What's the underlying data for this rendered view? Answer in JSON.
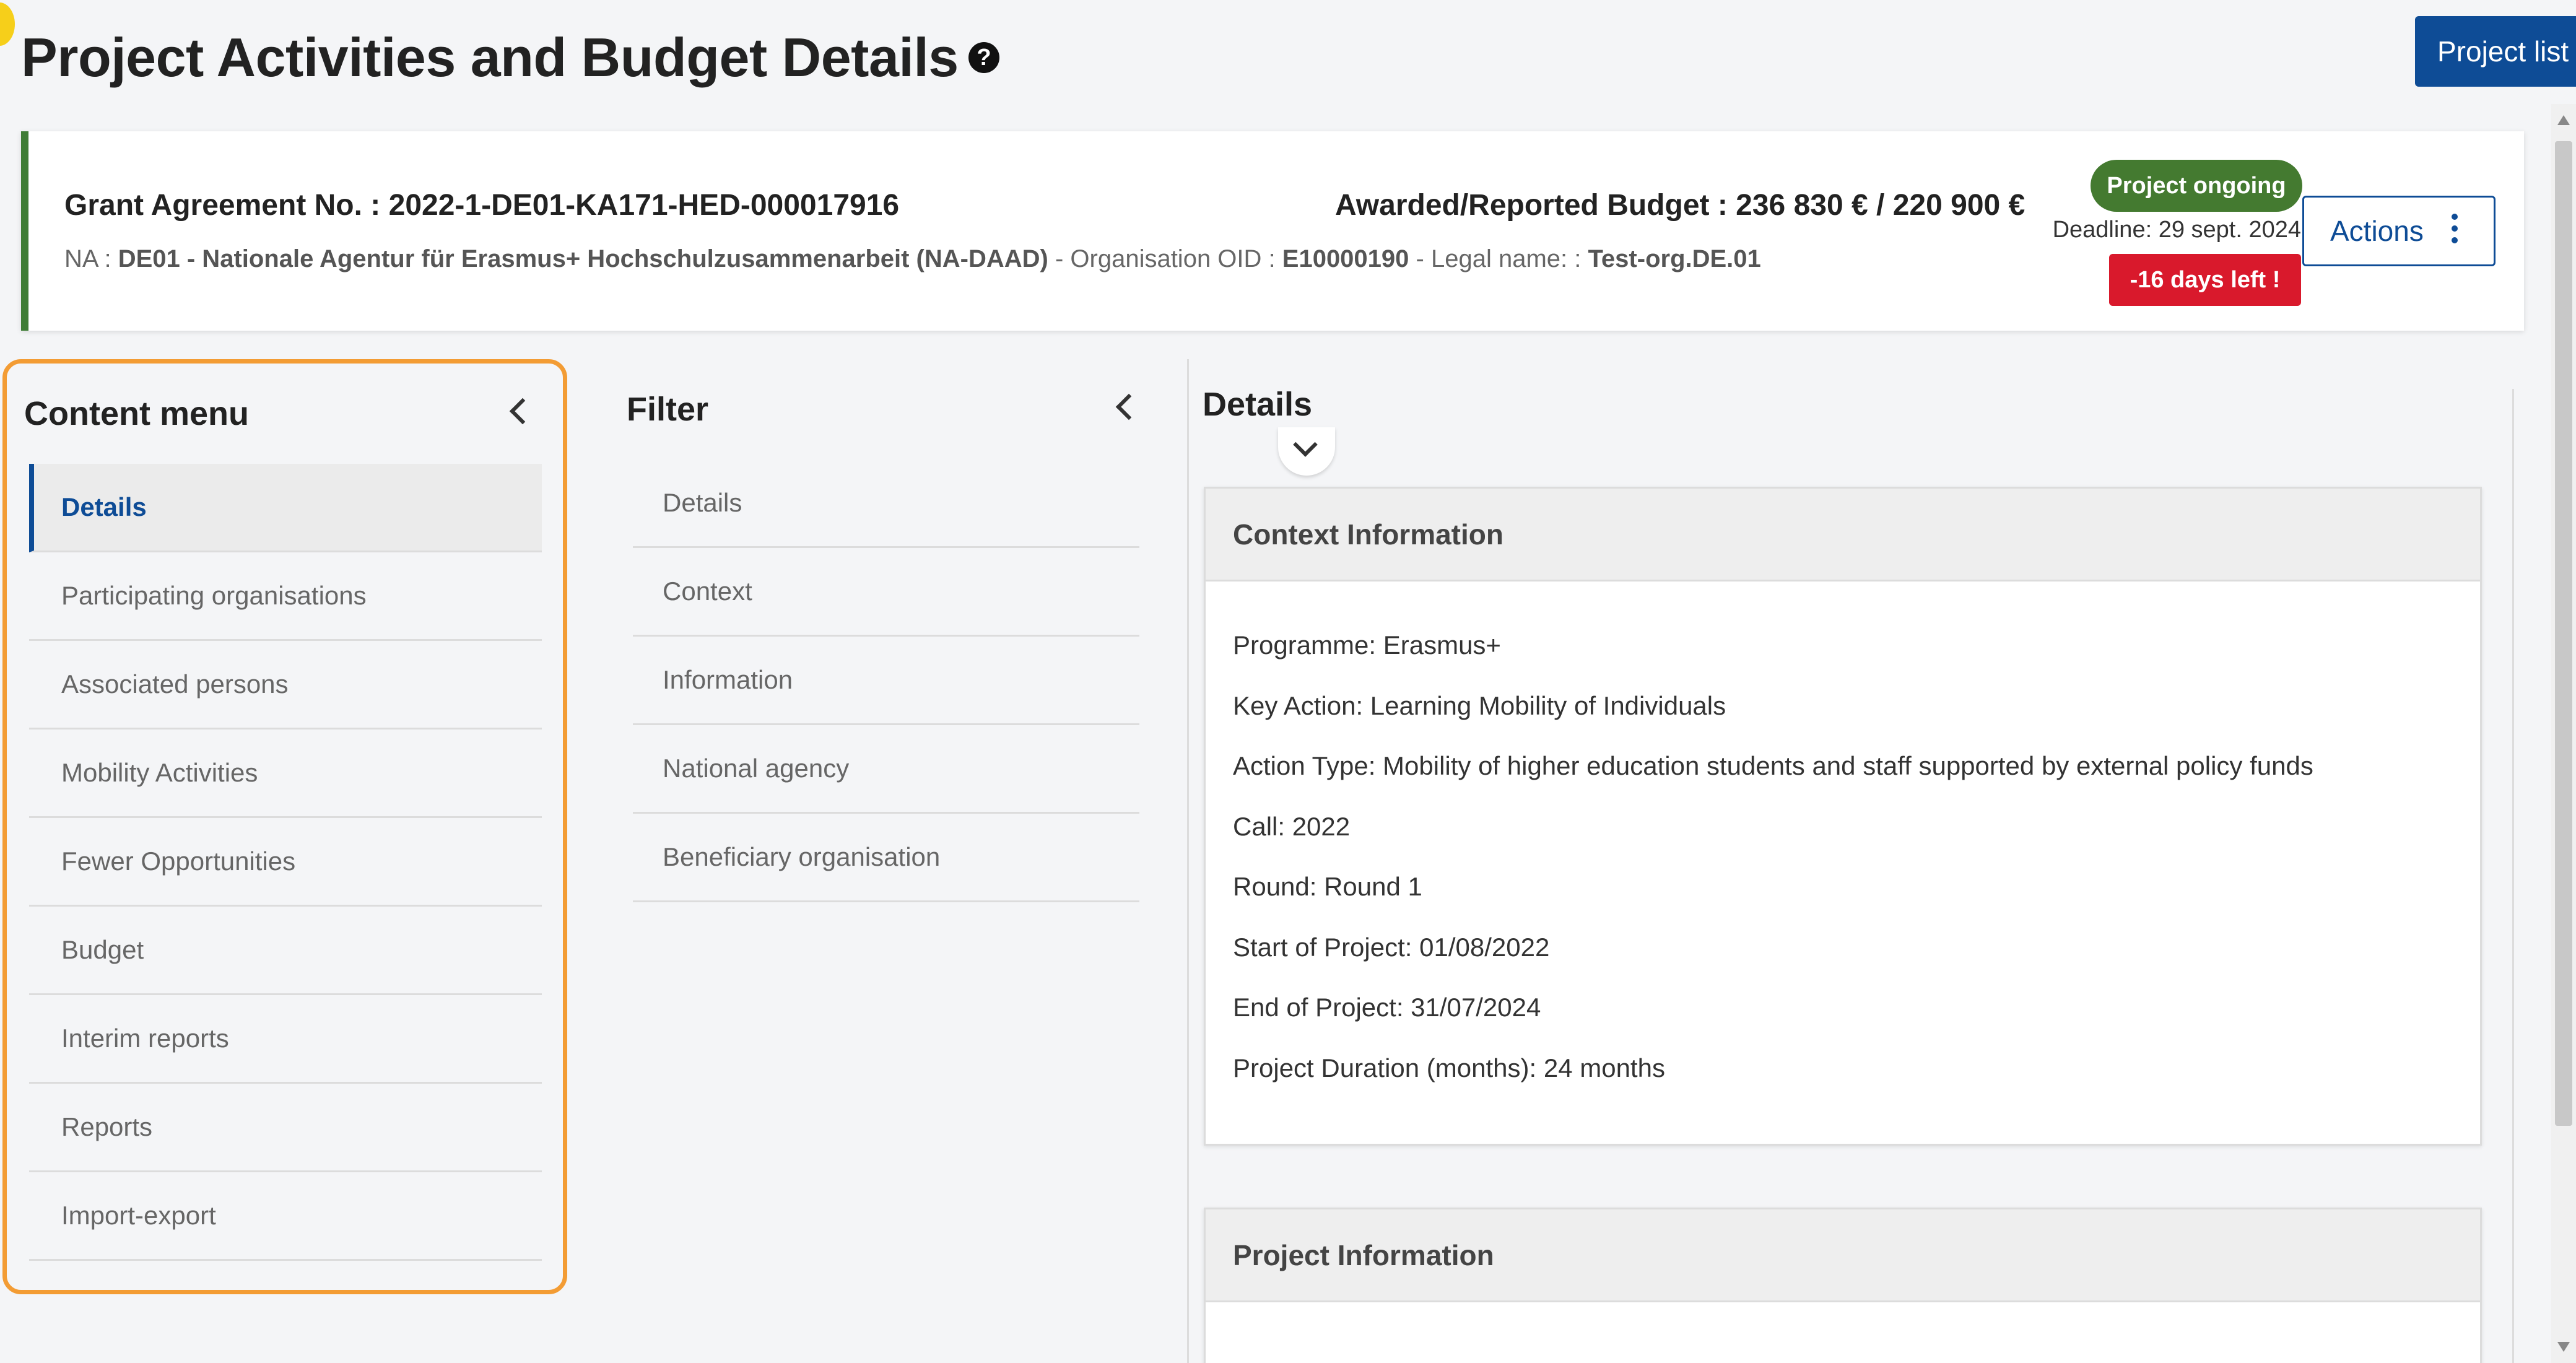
{
  "header": {
    "title": "Project Activities and Budget Details",
    "help_icon_glyph": "?",
    "project_list_label": "Project list"
  },
  "grant": {
    "agreement": "Grant Agreement No. : 2022-1-DE01-KA171-HED-000017916",
    "na_label": "NA : ",
    "na_value": "DE01 - Nationale Agentur für Erasmus+ Hochschulzusammenarbeit (NA-DAAD)",
    "oid_label": " - Organisation OID : ",
    "oid_value": "E10000190",
    "legal_label": " - Legal name: : ",
    "legal_value": "Test-org.DE.01",
    "budget": "Awarded/Reported Budget : 236 830 € / 220 900 €",
    "status": "Project ongoing",
    "deadline": "Deadline: 29 sept. 2024",
    "days_left": "-16 days left !",
    "actions_label": "Actions"
  },
  "content_menu": {
    "title": "Content menu",
    "items": [
      {
        "label": "Details",
        "active": true
      },
      {
        "label": "Participating organisations"
      },
      {
        "label": "Associated persons"
      },
      {
        "label": "Mobility Activities"
      },
      {
        "label": "Fewer Opportunities"
      },
      {
        "label": "Budget"
      },
      {
        "label": "Interim reports"
      },
      {
        "label": "Reports"
      },
      {
        "label": "Import-export"
      }
    ]
  },
  "filter": {
    "title": "Filter",
    "items": [
      "Details",
      "Context",
      "Information",
      "National agency",
      "Beneficiary organisation"
    ]
  },
  "details": {
    "title": "Details",
    "context": {
      "header": "Context Information",
      "lines": [
        "Programme: Erasmus+",
        "Key Action: Learning Mobility of Individuals",
        "Action Type: Mobility of higher education students and staff supported by external policy funds",
        "Call: 2022",
        "Round: Round 1",
        "Start of Project: 01/08/2022",
        "End of Project: 31/07/2024",
        "Project Duration (months): 24 months"
      ]
    },
    "project_info": {
      "header": "Project Information"
    }
  },
  "colors": {
    "primary": "#0e4c96",
    "status_green": "#447a30",
    "alert_red": "#d9192c",
    "highlight_orange": "#f39c34"
  }
}
